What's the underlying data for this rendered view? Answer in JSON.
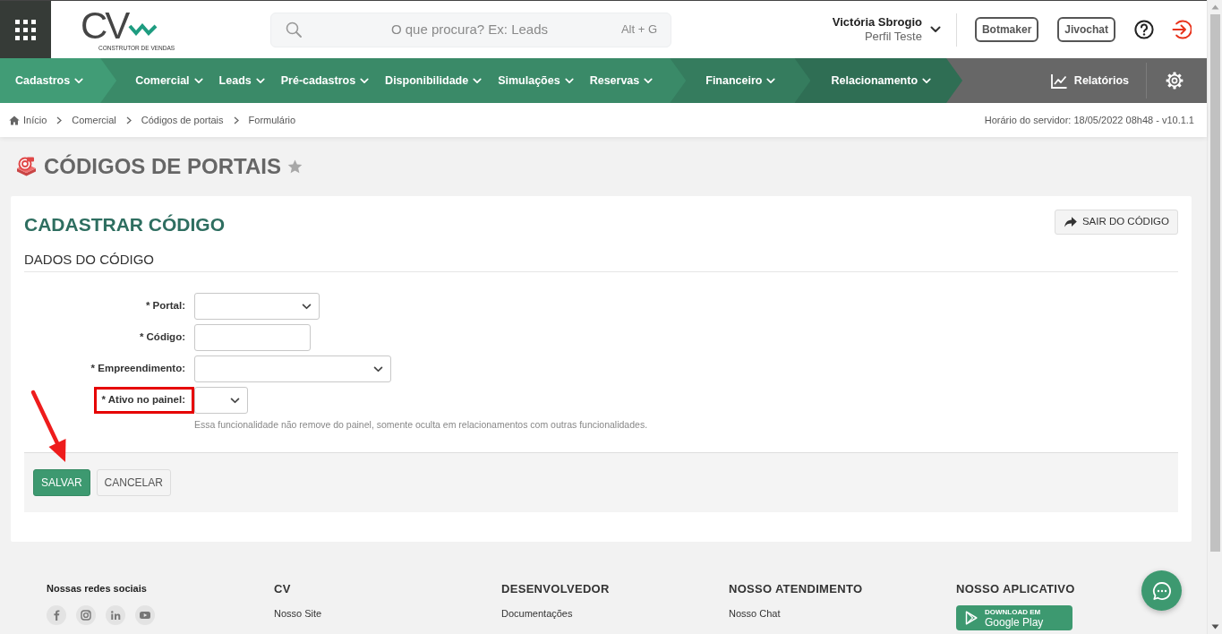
{
  "header": {
    "logo": {
      "mark": "CV",
      "tagline": "CONSTRUTOR DE VENDAS"
    },
    "search": {
      "placeholder": "O que procura? Ex: Leads",
      "shortcut": "Alt + G"
    },
    "user": {
      "name": "Victória Sbrogio",
      "profile": "Perfil Teste"
    },
    "buttons": [
      "Botmaker",
      "Jivochat"
    ]
  },
  "nav": {
    "groups": [
      {
        "items": [
          "Cadastros"
        ]
      },
      {
        "items": [
          "Comercial",
          "Leads",
          "Pré-cadastros",
          "Disponibilidade",
          "Simulações",
          "Reservas"
        ]
      },
      {
        "items": [
          "Financeiro"
        ]
      },
      {
        "items": [
          "Relacionamento"
        ]
      }
    ],
    "reports": "Relatórios"
  },
  "breadcrumb": {
    "items": [
      "Início",
      "Comercial",
      "Códigos de portais",
      "Formulário"
    ],
    "server_time": "Horário do servidor: 18/05/2022 08h48 - v10.1.1"
  },
  "page": {
    "title": "CÓDIGOS DE PORTAIS",
    "favorite": false
  },
  "card": {
    "title": "CADASTRAR CÓDIGO",
    "exit_button": "SAIR DO CÓDIGO",
    "section": "DADOS DO CÓDIGO",
    "fields": [
      {
        "kind": "select",
        "label": "* Portal:",
        "highlighted": false
      },
      {
        "kind": "text",
        "label": "* Código:",
        "highlighted": false
      },
      {
        "kind": "select",
        "label": "* Empreendimento:",
        "highlighted": false
      },
      {
        "kind": "select",
        "label": "* Ativo no painel:",
        "highlighted": true,
        "help": "Essa funcionalidade não remove do painel, somente oculta em relacionamentos com outras funcionalidades."
      }
    ],
    "actions": [
      {
        "kind": "primary",
        "label": "SALVAR",
        "arrow": true
      },
      {
        "kind": "secondary",
        "label": "CANCELAR",
        "arrow": false
      }
    ]
  },
  "footer": {
    "social_title": "Nossas redes sociais",
    "columns": [
      {
        "title": "CV",
        "links": [
          "Nosso Site"
        ]
      },
      {
        "title": "DESENVOLVEDOR",
        "links": [
          "Documentações"
        ]
      },
      {
        "title": "NOSSO ATENDIMENTO",
        "links": [
          "Nosso Chat"
        ]
      },
      {
        "title": "NOSSO APLICATIVO",
        "badge": {
          "caption": "DOWNLOAD EM",
          "store": "Google Play"
        }
      }
    ]
  }
}
